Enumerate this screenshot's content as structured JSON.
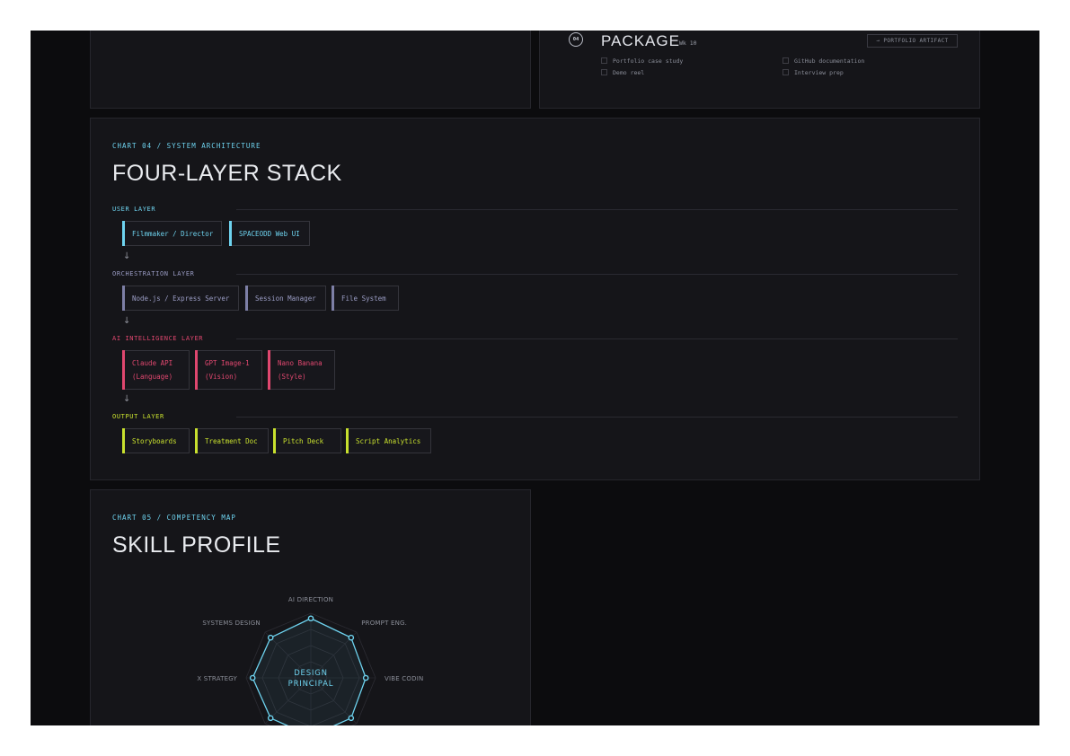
{
  "package": {
    "number": "04",
    "title": "PACKAGE",
    "week": "Wk 10",
    "artifact_button": "→ PORTFOLIO ARTIFACT",
    "checklist": [
      {
        "label": "Portfolio case study"
      },
      {
        "label": "Demo reel"
      },
      {
        "label": "GitHub documentation"
      },
      {
        "label": "Interview prep"
      }
    ]
  },
  "architecture": {
    "kicker": "CHART 04 / SYSTEM ARCHITECTURE",
    "title": "FOUR-LAYER STACK",
    "arrow": "↓",
    "layers": [
      {
        "label": "USER LAYER",
        "color": "#6ed3ef",
        "items": [
          {
            "line1": "Filmmaker / Director",
            "line2": ""
          },
          {
            "line1": "SPACEODD Web UI",
            "line2": ""
          }
        ]
      },
      {
        "label": "ORCHESTRATION LAYER",
        "color": "#9a9cc4",
        "items": [
          {
            "line1": "Node.js / Express Server",
            "line2": ""
          },
          {
            "line1": "Session Manager",
            "line2": ""
          },
          {
            "line1": "File System",
            "line2": ""
          }
        ]
      },
      {
        "label": "AI INTELLIGENCE LAYER",
        "color": "#e0476f",
        "items": [
          {
            "line1": "Claude API",
            "line2": "(Language)"
          },
          {
            "line1": "GPT Image-1",
            "line2": "(Vision)"
          },
          {
            "line1": "Nano Banana",
            "line2": "(Style)"
          }
        ]
      },
      {
        "label": "OUTPUT LAYER",
        "color": "#c8e02e",
        "items": [
          {
            "line1": "Storyboards",
            "line2": ""
          },
          {
            "line1": "Treatment Doc",
            "line2": ""
          },
          {
            "line1": "Pitch Deck",
            "line2": ""
          },
          {
            "line1": "Script Analytics",
            "line2": ""
          }
        ]
      }
    ]
  },
  "skills": {
    "kicker": "CHART 05 / COMPETENCY MAP",
    "title": "SKILL PROFILE",
    "center_line1": "DESIGN",
    "center_line2": "PRINCIPAL",
    "axes": [
      "AI DIRECTION",
      "PROMPT ENG.",
      "VIBE CODIN",
      "",
      "",
      "",
      "X STRATEGY",
      "SYSTEMS DESIGN"
    ],
    "values": [
      0.92,
      0.88,
      0.85,
      0.88,
      0.9,
      0.88,
      0.9,
      0.88
    ],
    "accent": "#6ed3ef"
  }
}
